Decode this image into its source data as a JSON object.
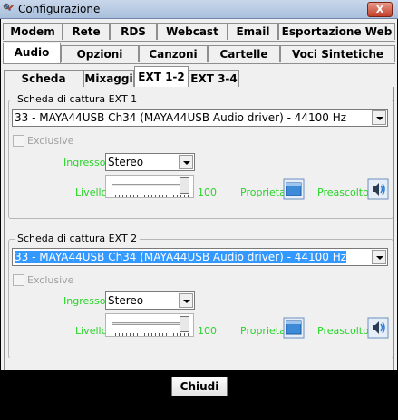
{
  "window": {
    "title": "Configurazione",
    "close_label": "X"
  },
  "tabs_row1": [
    "Modem",
    "Rete",
    "RDS",
    "Webcast",
    "Email",
    "Esportazione Web"
  ],
  "tabs_row2": [
    "Audio",
    "Opzioni",
    "Canzoni",
    "Cartelle",
    "Voci Sintetiche"
  ],
  "subtabs": [
    "Scheda Audio",
    "Mixaggi",
    "EXT 1-2",
    "EXT 3-4"
  ],
  "selected_subtab": "EXT 1-2",
  "ext1": {
    "legend": "Scheda di cattura EXT 1",
    "device": "33 - MAYA44USB Ch34 (MAYA44USB Audio driver) - 44100 Hz",
    "exclusive_label": "Exclusive",
    "input_label": "Ingresso:",
    "input_value": "Stereo",
    "level_label": "Livello:",
    "level_value": "100",
    "level_fraction": 1.0,
    "properties_label": "Proprieta'",
    "preview_label": "Preascolto"
  },
  "ext2": {
    "legend": "Scheda di cattura EXT 2",
    "device": "33 - MAYA44USB Ch34 (MAYA44USB Audio driver) - 44100 Hz",
    "exclusive_label": "Exclusive",
    "input_label": "Ingresso:",
    "input_value": "Stereo",
    "level_label": "Livello:",
    "level_value": "100",
    "level_fraction": 1.0,
    "properties_label": "Proprieta'",
    "preview_label": "Preascolto"
  },
  "footer": {
    "close_button": "Chiudi"
  },
  "colors": {
    "label_green": "#27d427",
    "selection_blue": "#3399ff",
    "disabled_gray": "#a0a0a0"
  }
}
